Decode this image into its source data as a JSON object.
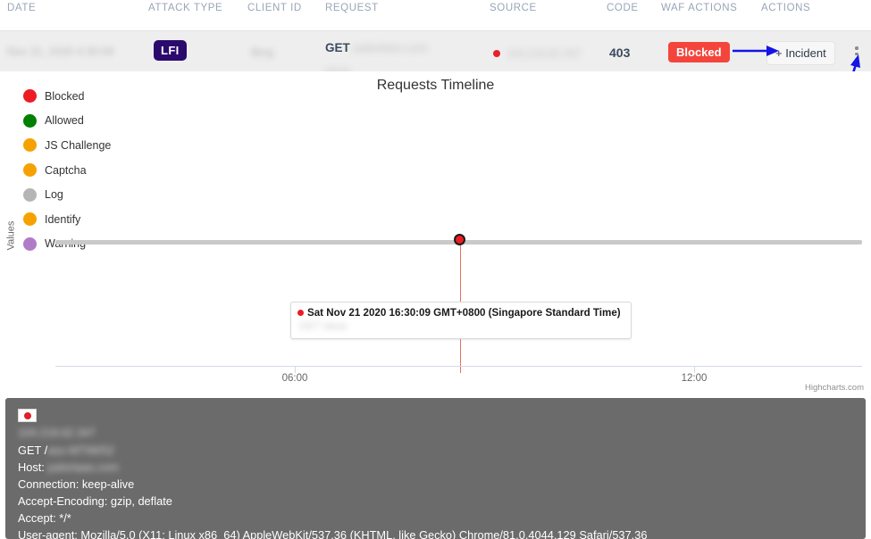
{
  "table": {
    "headers": {
      "date": "DATE",
      "attack_type": "ATTACK TYPE",
      "client_id": "CLIENT ID",
      "request": "REQUEST",
      "source": "SOURCE",
      "code": "CODE",
      "waf_actions": "WAF ACTIONS",
      "actions": "ACTIONS"
    },
    "row": {
      "date": "Nov 21, 2020 4:30:09",
      "attack_type": "LFI",
      "attack_type_color": "#2b0a6e",
      "client_id": "Bing",
      "request_verb": "GET",
      "request_host": "palantass.com",
      "request_path": "/asss",
      "source_flag": "japan-flag",
      "source_ip": "104.218.62.347",
      "code": "403",
      "waf_action": "Blocked",
      "waf_action_color": "#f4453c",
      "incident_button": "+ Incident",
      "menu_icon": "kebab-menu-icon"
    }
  },
  "chart": {
    "title": "Requests Timeline",
    "y_axis_title": "Values",
    "credits": "Highcharts.com",
    "tooltip": {
      "line1": "Sat Nov 21 2020 16:30:09 GMT+0800 (Singapore Standard Time)",
      "line2": "GET /asss"
    }
  },
  "chart_data": {
    "type": "scatter",
    "title": "Requests Timeline",
    "xlabel": "",
    "ylabel": "Values",
    "grid": false,
    "legend_position": "left-top",
    "x_tick_labels": [
      "06:00",
      "12:00"
    ],
    "x_tick_positions_pct": [
      29.7,
      79.2
    ],
    "series": [
      {
        "name": "Blocked",
        "color": "#ed1c24",
        "points": [
          {
            "x": "16:30:09",
            "y": 1,
            "label": "Sat Nov 21 2020 16:30:09 GMT+0800 (Singapore Standard Time)"
          }
        ]
      },
      {
        "name": "Allowed",
        "color": "#008000",
        "points": []
      },
      {
        "name": "JS Challenge",
        "color": "#f5a201",
        "points": []
      },
      {
        "name": "Captcha",
        "color": "#f5a201",
        "points": []
      },
      {
        "name": "Log",
        "color": "#b5b5b5",
        "points": []
      },
      {
        "name": "Identify",
        "color": "#f5a201",
        "points": []
      },
      {
        "name": "Warning",
        "color": "#b07cc6",
        "points": []
      }
    ],
    "legend": [
      {
        "label": "Blocked",
        "color": "#ed1c24"
      },
      {
        "label": "Allowed",
        "color": "#008000"
      },
      {
        "label": "JS Challenge",
        "color": "#f5a201"
      },
      {
        "label": "Captcha",
        "color": "#f5a201"
      },
      {
        "label": "Log",
        "color": "#b5b5b5"
      },
      {
        "label": "Identify",
        "color": "#f5a201"
      },
      {
        "label": "Warning",
        "color": "#b07cc6"
      }
    ]
  },
  "raw_request": {
    "flag": "japan-flag",
    "ip": "104.218.62.347",
    "lines": [
      "GET /ass-MT99/52",
      "Host: palsrtaas.com",
      "Connection: keep-alive",
      "Accept-Encoding: gzip, deflate",
      "Accept: */*",
      "User-agent: Mozilla/5.0 (X11; Linux x86_64) AppleWebKit/537.36 (KHTML, like Gecko) Chrome/81.0.4044.129 Safari/537.36"
    ],
    "line_request": "GET /",
    "line_request_blur": "ass-MT99/52",
    "line_host": "Host:",
    "line_host_blur": "palsrtaas.com",
    "line_connection": "Connection: keep-alive",
    "line_encoding": "Accept-Encoding: gzip, deflate",
    "line_accept": "Accept: */*",
    "line_ua": "User-agent: Mozilla/5.0 (X11; Linux x86_64) AppleWebKit/537.36 (KHTML, like Gecko) Chrome/81.0.4044.129 Safari/537.36"
  },
  "annotations": {
    "arrow_color": "#1414e6",
    "arrow_incident": "arrow-pointing-to-incident-button",
    "arrow_menu": "arrow-pointing-to-kebab-menu"
  }
}
